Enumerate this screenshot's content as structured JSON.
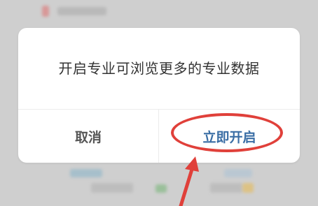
{
  "dialog": {
    "message": "开启专业可浏览更多的专业数据",
    "cancel_label": "取消",
    "confirm_label": "立即开启"
  },
  "colors": {
    "overlay": "#cfcfcf",
    "dialog_bg": "#ffffff",
    "message_text": "#333333",
    "cancel_text": "#555555",
    "confirm_text": "#3a6ea5",
    "annotation": "#e0403a"
  },
  "annotation": {
    "shape": "ellipse-around-confirm-button",
    "pointer": "arrow-up-pointing-at-confirm-button"
  }
}
